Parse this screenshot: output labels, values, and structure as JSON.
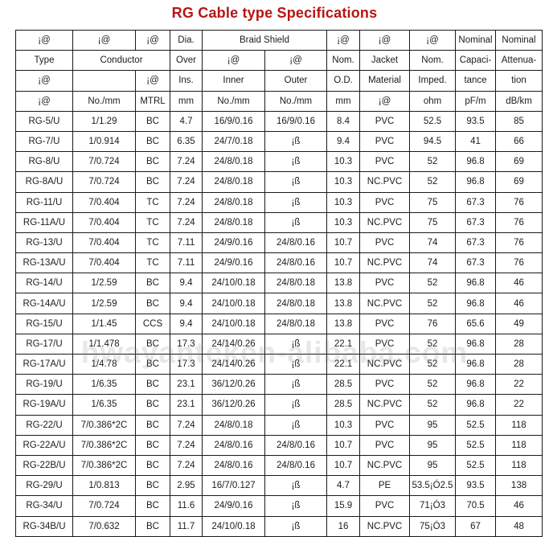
{
  "title": "RG Cable type Specifications",
  "watermark": "hwayanteken-alibaba.com",
  "theme": {
    "title_color": "#b81414",
    "border_color": "#1a1a1a",
    "text_color": "#1c1c1c",
    "background": "#ffffff"
  },
  "table": {
    "header_rows": [
      {
        "cells": [
          {
            "text": "¡@",
            "rowspan": 1,
            "colspan": 1
          },
          {
            "text": "¡@",
            "rowspan": 1,
            "colspan": 1
          },
          {
            "text": "¡@",
            "rowspan": 1,
            "colspan": 1
          },
          {
            "text": "Dia.",
            "rowspan": 1,
            "colspan": 1
          },
          {
            "text": "Braid Shield",
            "rowspan": 1,
            "colspan": 2
          },
          {
            "text": "¡@",
            "rowspan": 1,
            "colspan": 1
          },
          {
            "text": "¡@",
            "rowspan": 1,
            "colspan": 1
          },
          {
            "text": "¡@",
            "rowspan": 1,
            "colspan": 1
          },
          {
            "text": "Nominal",
            "rowspan": 1,
            "colspan": 1
          },
          {
            "text": "Nominal",
            "rowspan": 1,
            "colspan": 1
          }
        ]
      },
      {
        "cells": [
          {
            "text": "Type",
            "rowspan": 1,
            "colspan": 1
          },
          {
            "text": "Conductor",
            "rowspan": 1,
            "colspan": 2
          },
          {
            "text": "Over",
            "rowspan": 1,
            "colspan": 1
          },
          {
            "text": "¡@",
            "rowspan": 1,
            "colspan": 1
          },
          {
            "text": "¡@",
            "rowspan": 1,
            "colspan": 1
          },
          {
            "text": "Nom.",
            "rowspan": 1,
            "colspan": 1
          },
          {
            "text": "Jacket",
            "rowspan": 1,
            "colspan": 1
          },
          {
            "text": "Nom.",
            "rowspan": 1,
            "colspan": 1
          },
          {
            "text": "Capaci-",
            "rowspan": 1,
            "colspan": 1
          },
          {
            "text": "Attenua-",
            "rowspan": 1,
            "colspan": 1
          }
        ]
      },
      {
        "cells": [
          {
            "text": "¡@",
            "rowspan": 1,
            "colspan": 1
          },
          {
            "text": "",
            "rowspan": 1,
            "colspan": 1
          },
          {
            "text": "¡@",
            "rowspan": 1,
            "colspan": 1
          },
          {
            "text": "Ins.",
            "rowspan": 1,
            "colspan": 1
          },
          {
            "text": "Inner",
            "rowspan": 1,
            "colspan": 1
          },
          {
            "text": "Outer",
            "rowspan": 1,
            "colspan": 1
          },
          {
            "text": "O.D.",
            "rowspan": 1,
            "colspan": 1
          },
          {
            "text": "Material",
            "rowspan": 1,
            "colspan": 1
          },
          {
            "text": "Imped.",
            "rowspan": 1,
            "colspan": 1
          },
          {
            "text": "tance",
            "rowspan": 1,
            "colspan": 1
          },
          {
            "text": "tion",
            "rowspan": 1,
            "colspan": 1
          }
        ]
      },
      {
        "cells": [
          {
            "text": "¡@",
            "rowspan": 1,
            "colspan": 1
          },
          {
            "text": "No./mm",
            "rowspan": 1,
            "colspan": 1
          },
          {
            "text": "MTRL",
            "rowspan": 1,
            "colspan": 1
          },
          {
            "text": "mm",
            "rowspan": 1,
            "colspan": 1
          },
          {
            "text": "No./mm",
            "rowspan": 1,
            "colspan": 1
          },
          {
            "text": "No./mm",
            "rowspan": 1,
            "colspan": 1
          },
          {
            "text": "mm",
            "rowspan": 1,
            "colspan": 1
          },
          {
            "text": "¡@",
            "rowspan": 1,
            "colspan": 1
          },
          {
            "text": "ohm",
            "rowspan": 1,
            "colspan": 1
          },
          {
            "text": "pF/m",
            "rowspan": 1,
            "colspan": 1
          },
          {
            "text": "dB/km",
            "rowspan": 1,
            "colspan": 1
          }
        ]
      }
    ],
    "rows": [
      {
        "thick_top": false,
        "cells": [
          "RG-5/U",
          "1/1.29",
          "BC",
          "4.7",
          "16/9/0.16",
          "16/9/0.16",
          "8.4",
          "PVC",
          "52.5",
          "93.5",
          "85"
        ]
      },
      {
        "thick_top": false,
        "cells": [
          "RG-7/U",
          "1/0.914",
          "BC",
          "6.35",
          "24/7/0.18",
          "¡ß",
          "9.4",
          "PVC",
          "94.5",
          "41",
          "66"
        ]
      },
      {
        "thick_top": false,
        "cells": [
          "RG-8/U",
          "7/0.724",
          "BC",
          "7.24",
          "24/8/0.18",
          "¡ß",
          "10.3",
          "PVC",
          "52",
          "96.8",
          "69"
        ]
      },
      {
        "thick_top": false,
        "cells": [
          "RG-8A/U",
          "7/0.724",
          "BC",
          "7.24",
          "24/8/0.18",
          "¡ß",
          "10.3",
          "NC.PVC",
          "52",
          "96.8",
          "69"
        ]
      },
      {
        "thick_top": false,
        "cells": [
          "RG-11/U",
          "7/0.404",
          "TC",
          "7.24",
          "24/8/0.18",
          "¡ß",
          "10.3",
          "PVC",
          "75",
          "67.3",
          "76"
        ]
      },
      {
        "thick_top": false,
        "cells": [
          "RG-11A/U",
          "7/0.404",
          "TC",
          "7.24",
          "24/8/0.18",
          "¡ß",
          "10.3",
          "NC.PVC",
          "75",
          "67.3",
          "76"
        ]
      },
      {
        "thick_top": false,
        "cells": [
          "RG-13/U",
          "7/0.404",
          "TC",
          "7.11",
          "24/9/0.16",
          "24/8/0.16",
          "10.7",
          "PVC",
          "74",
          "67.3",
          "76"
        ]
      },
      {
        "thick_top": false,
        "cells": [
          "RG-13A/U",
          "7/0.404",
          "TC",
          "7.11",
          "24/9/0.16",
          "24/8/0.16",
          "10.7",
          "NC.PVC",
          "74",
          "67.3",
          "76"
        ]
      },
      {
        "thick_top": true,
        "cells": [
          "RG-14/U",
          "1/2.59",
          "BC",
          "9.4",
          "24/10/0.18",
          "24/8/0.18",
          "13.8",
          "PVC",
          "52",
          "96.8",
          "46"
        ]
      },
      {
        "thick_top": false,
        "cells": [
          "RG-14A/U",
          "1/2.59",
          "BC",
          "9.4",
          "24/10/0.18",
          "24/8/0.18",
          "13.8",
          "NC.PVC",
          "52",
          "96.8",
          "46"
        ]
      },
      {
        "thick_top": false,
        "cells": [
          "RG-15/U",
          "1/1.45",
          "CCS",
          "9.4",
          "24/10/0.18",
          "24/8/0.18",
          "13.8",
          "PVC",
          "76",
          "65.6",
          "49"
        ]
      },
      {
        "thick_top": true,
        "cells": [
          "RG-17/U",
          "1/1.478",
          "BC",
          "17.3",
          "24/14/0.26",
          "¡ß",
          "22.1",
          "PVC",
          "52",
          "96.8",
          "28"
        ]
      },
      {
        "thick_top": false,
        "cells": [
          "RG-17A/U",
          "1/4.78",
          "BC",
          "17.3",
          "24/14/0.26",
          "¡ß",
          "22.1",
          "NC.PVC",
          "52",
          "96.8",
          "28"
        ]
      },
      {
        "thick_top": false,
        "cells": [
          "RG-19/U",
          "1/6.35",
          "BC",
          "23.1",
          "36/12/0.26",
          "¡ß",
          "28.5",
          "PVC",
          "52",
          "96.8",
          "22"
        ]
      },
      {
        "thick_top": false,
        "cells": [
          "RG-19A/U",
          "1/6.35",
          "BC",
          "23.1",
          "36/12/0.26",
          "¡ß",
          "28.5",
          "NC.PVC",
          "52",
          "96.8",
          "22"
        ]
      },
      {
        "thick_top": true,
        "cells": [
          "RG-22/U",
          "7/0.386*2C",
          "BC",
          "7.24",
          "24/8/0.18",
          "¡ß",
          "10.3",
          "PVC",
          "95",
          "52.5",
          "118"
        ]
      },
      {
        "thick_top": false,
        "cells": [
          "RG-22A/U",
          "7/0.386*2C",
          "BC",
          "7.24",
          "24/8/0.16",
          "24/8/0.16",
          "10.7",
          "PVC",
          "95",
          "52.5",
          "118"
        ]
      },
      {
        "thick_top": true,
        "cells": [
          "RG-22B/U",
          "7/0.386*2C",
          "BC",
          "7.24",
          "24/8/0.16",
          "24/8/0.16",
          "10.7",
          "NC.PVC",
          "95",
          "52.5",
          "118"
        ]
      },
      {
        "thick_top": false,
        "cells": [
          "RG-29/U",
          "1/0.813",
          "BC",
          "2.95",
          "16/7/0.127",
          "¡ß",
          "4.7",
          "PE",
          "53.5¡Ó2.5",
          "93.5",
          "138"
        ]
      },
      {
        "thick_top": false,
        "cells": [
          "RG-34/U",
          "7/0.724",
          "BC",
          "11.6",
          "24/9/0.16",
          "¡ß",
          "15.9",
          "PVC",
          "71¡Ó3",
          "70.5",
          "46"
        ]
      },
      {
        "thick_top": false,
        "cells": [
          "RG-34B/U",
          "7/0.632",
          "BC",
          "11.7",
          "24/10/0.18",
          "¡ß",
          "16",
          "NC.PVC",
          "75¡Ó3",
          "67",
          "48"
        ]
      }
    ]
  }
}
